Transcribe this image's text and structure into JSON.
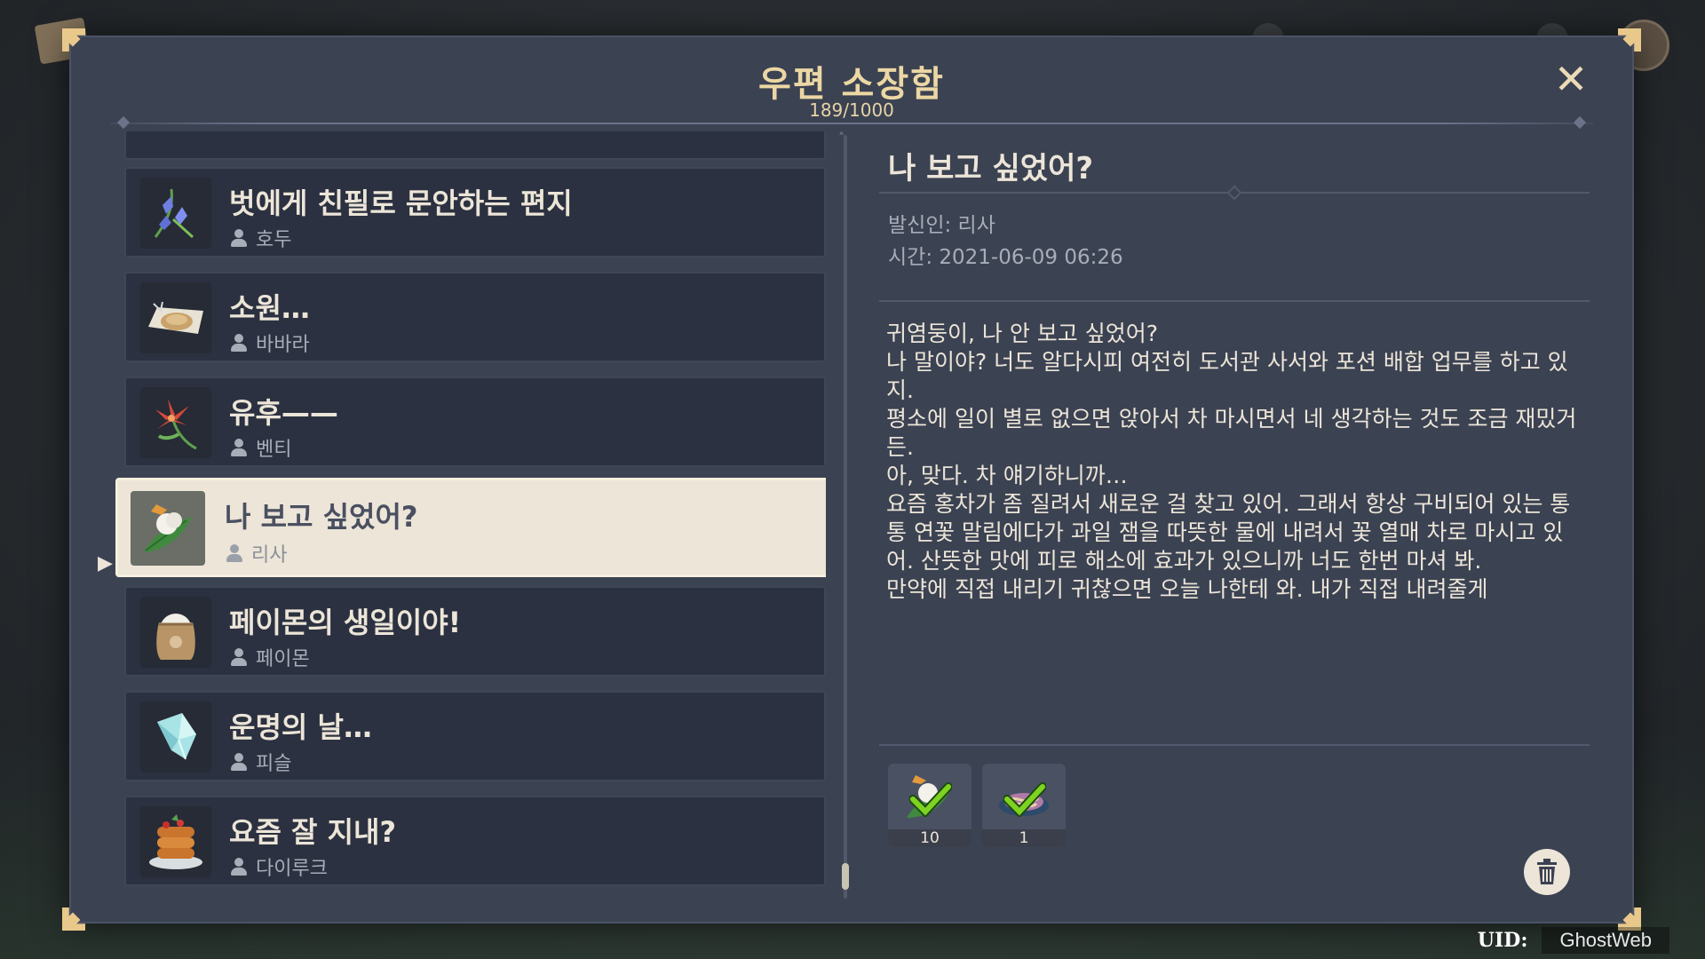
{
  "window": {
    "title": "우편 소장함",
    "count": "189/1000"
  },
  "list": [
    {
      "subject": "벗에게 친필로 문안하는 편지",
      "sender": "호두",
      "icon": "bellflower-icon",
      "selected": false
    },
    {
      "subject": "소원…",
      "sender": "바바라",
      "icon": "scroll-food-icon",
      "selected": false
    },
    {
      "subject": "유후——",
      "sender": "벤티",
      "icon": "red-lily-flower-icon",
      "selected": false
    },
    {
      "subject": "나 보고 싶었어?",
      "sender": "리사",
      "icon": "mint-dumpling-icon",
      "selected": true
    },
    {
      "subject": "페이몬의 생일이야!",
      "sender": "페이몬",
      "icon": "flour-sack-icon",
      "selected": false
    },
    {
      "subject": "운명의 날…",
      "sender": "피슬",
      "icon": "crystal-icon",
      "selected": false
    },
    {
      "subject": "요즘 잘 지내?",
      "sender": "다이루크",
      "icon": "pancake-stack-icon",
      "selected": false
    }
  ],
  "detail": {
    "subject": "나 보고 싶었어?",
    "sender": "발신인: 리사",
    "time": "시간: 2021-06-09 06:26",
    "body": [
      "귀염둥이, 나 안 보고 싶었어?",
      "나 말이야? 너도 알다시피 여전히 도서관 사서와 포션 배합 업무를 하고 있지.",
      "평소에 일이 별로 없으면 앉아서 차 마시면서 네 생각하는 것도 조금 재밌거든.",
      "아, 맞다. 차 얘기하니까…",
      "요즘 홍차가 좀 질려서 새로운 걸 찾고 있어. 그래서 항상 구비되어 있는 통통 연꽃 말림에다가 과일 잼을 따뜻한 물에 내려서 꽃 열매 차로 마시고 있어. 산뜻한 맛에 피로 해소에 효과가 있으니까 너도 한번 마셔 봐.",
      "만약에 직접 내리기 귀찮으면 오늘 나한테 와. 내가 직접 내려줄게"
    ],
    "rewards": [
      {
        "icon": "mint-dumpling-icon",
        "qty": "10",
        "claimed": true
      },
      {
        "icon": "noodle-dish-icon",
        "qty": "1",
        "claimed": true
      }
    ]
  },
  "uid": {
    "label": "UID:",
    "value": "GhostWeb"
  },
  "colors": {
    "accent_gold": "#ecd7a4",
    "panel": "#3b4252",
    "item": "#2b3140",
    "selected": "#ece5d8",
    "check_green": "#7ed321"
  }
}
